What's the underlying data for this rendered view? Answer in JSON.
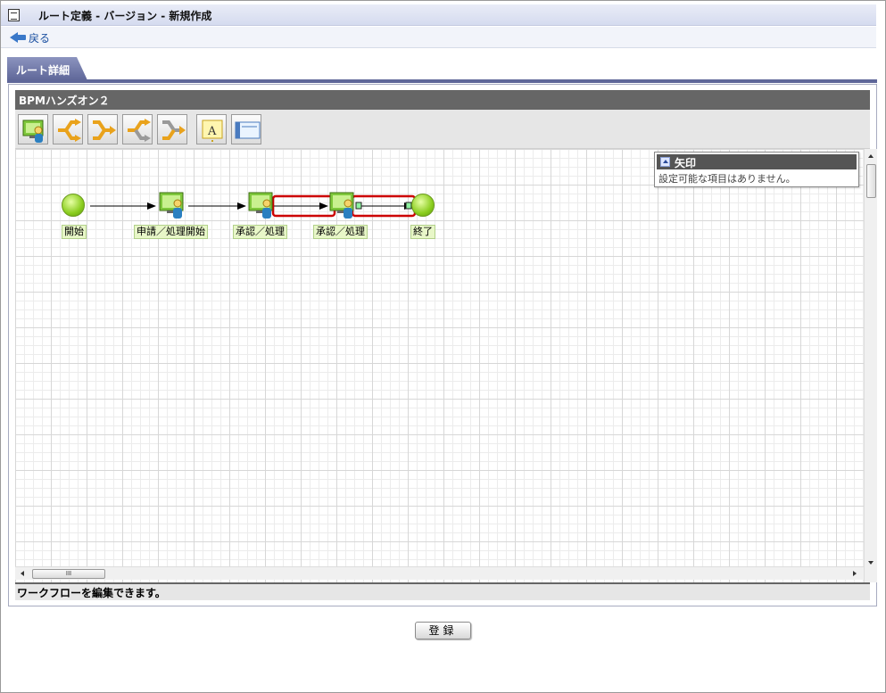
{
  "window": {
    "title": "ルート定義 - バージョン - 新規作成"
  },
  "nav": {
    "back_label": "戻る"
  },
  "tabs": [
    {
      "label": "ルート詳細"
    }
  ],
  "editor": {
    "title": "BPMハンズオン２",
    "toolbar_buttons": [
      {
        "name": "node-tool-icon"
      },
      {
        "name": "branch-tool-icon"
      },
      {
        "name": "join-tool-icon"
      },
      {
        "name": "branch-gray-tool-icon"
      },
      {
        "name": "join-gray-tool-icon"
      },
      {
        "name": "text-tool-icon"
      },
      {
        "name": "frame-tool-icon"
      }
    ],
    "property_panel": {
      "title": "矢印",
      "text": "設定可能な項目はありません。"
    },
    "nodes": [
      {
        "label": "開始"
      },
      {
        "label": "申請／処理開始"
      },
      {
        "label": "承認／処理"
      },
      {
        "label": "承認／処理"
      },
      {
        "label": "終了"
      }
    ],
    "hscroll_thumb": "III",
    "status": "ワークフローを編集できます。"
  },
  "actions": {
    "register_label": "登録"
  },
  "colors": {
    "accent": "#5f6799",
    "selection": "#cc0000",
    "node_green": "#8acd1e"
  }
}
